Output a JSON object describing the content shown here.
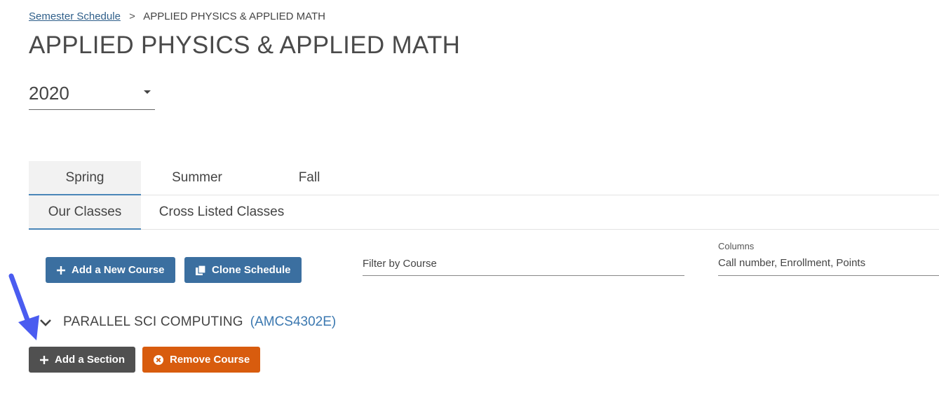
{
  "breadcrumb": {
    "link": "Semester Schedule",
    "separator": ">",
    "current": "APPLIED PHYSICS & APPLIED MATH"
  },
  "page_title": "APPLIED PHYSICS & APPLIED MATH",
  "year_select": {
    "value": "2020"
  },
  "term_tabs": [
    {
      "label": "Spring",
      "active": true
    },
    {
      "label": "Summer",
      "active": false
    },
    {
      "label": "Fall",
      "active": false
    }
  ],
  "class_tabs": [
    {
      "label": "Our Classes",
      "active": true
    },
    {
      "label": "Cross Listed Classes",
      "active": false
    }
  ],
  "toolbar": {
    "add_course_label": "Add a New Course",
    "clone_schedule_label": "Clone Schedule",
    "filter_placeholder": "Filter by Course",
    "columns_label": "Columns",
    "columns_value": "Call number, Enrollment, Points"
  },
  "course": {
    "name": "PARALLEL SCI COMPUTING",
    "code": "(AMCS4302E)",
    "add_section_label": "Add a Section",
    "remove_course_label": "Remove Course"
  },
  "colors": {
    "link": "#2f5f8a",
    "primary_button": "#3b6fa0",
    "dark_button": "#505050",
    "danger_button": "#d85c0e",
    "annotation_arrow": "#4a5cf0",
    "course_code": "#3b78b0"
  }
}
